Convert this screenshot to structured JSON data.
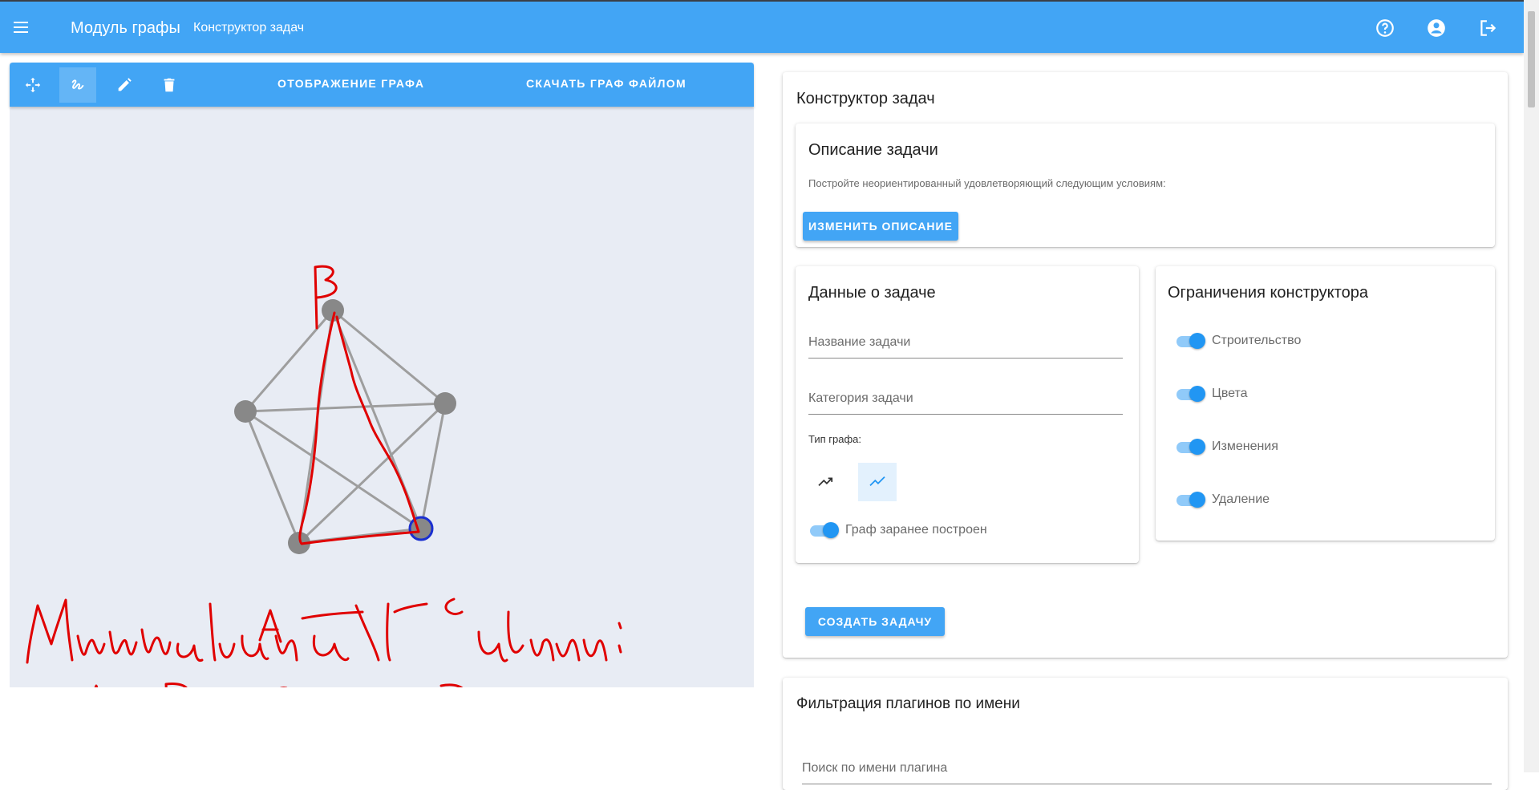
{
  "appbar": {
    "menu_icon": "menu-icon",
    "title": "Модуль графы",
    "subtitle": "Конструктор задач",
    "actions": [
      "help-icon",
      "account-icon",
      "logout-icon"
    ],
    "color": "#42a5f5"
  },
  "graph_toolbar": {
    "tools": [
      "move-icon",
      "draw-icon",
      "edit-icon",
      "delete-icon"
    ],
    "active_tool": "draw-icon",
    "display_graph_label": "ОТОБРАЖЕНИЕ ГРАФА",
    "download_graph_label": "СКАЧАТЬ ГРАФ ФАЙЛОМ"
  },
  "graph": {
    "node_color": "#888888",
    "edge_color": "#9e9e9e",
    "selected_node_outline": "#1a2fd0",
    "annotation_color": "#e00000"
  },
  "constructor": {
    "title": "Конструктор задач",
    "description_card": {
      "title": "Описание задачи",
      "text": "Постройте неориентированный удовлетворяющий следующим условиям:",
      "change_button": "ИЗМЕНИТЬ ОПИСАНИЕ"
    },
    "task_data": {
      "title": "Данные о задаче",
      "name_placeholder": "Название задачи",
      "category_placeholder": "Категория задачи",
      "graph_type_label": "Тип графа:",
      "graph_types": [
        "directed-graph-icon",
        "undirected-graph-icon"
      ],
      "selected_graph_type": "undirected-graph-icon",
      "prebuilt_toggle_label": "Граф заранее построен",
      "prebuilt_toggle_on": true
    },
    "constraints": {
      "title": "Ограничения конструктора",
      "items": [
        {
          "label": "Строительство",
          "on": true
        },
        {
          "label": "Цвета",
          "on": true
        },
        {
          "label": "Изменения",
          "on": true
        },
        {
          "label": "Удаление",
          "on": true
        }
      ]
    },
    "create_button": "СОЗДАТЬ ЗАДАЧУ"
  },
  "plugins_filter": {
    "title": "Фильтрация плагинов по имени",
    "search_placeholder": "Поиск по имени плагина"
  }
}
